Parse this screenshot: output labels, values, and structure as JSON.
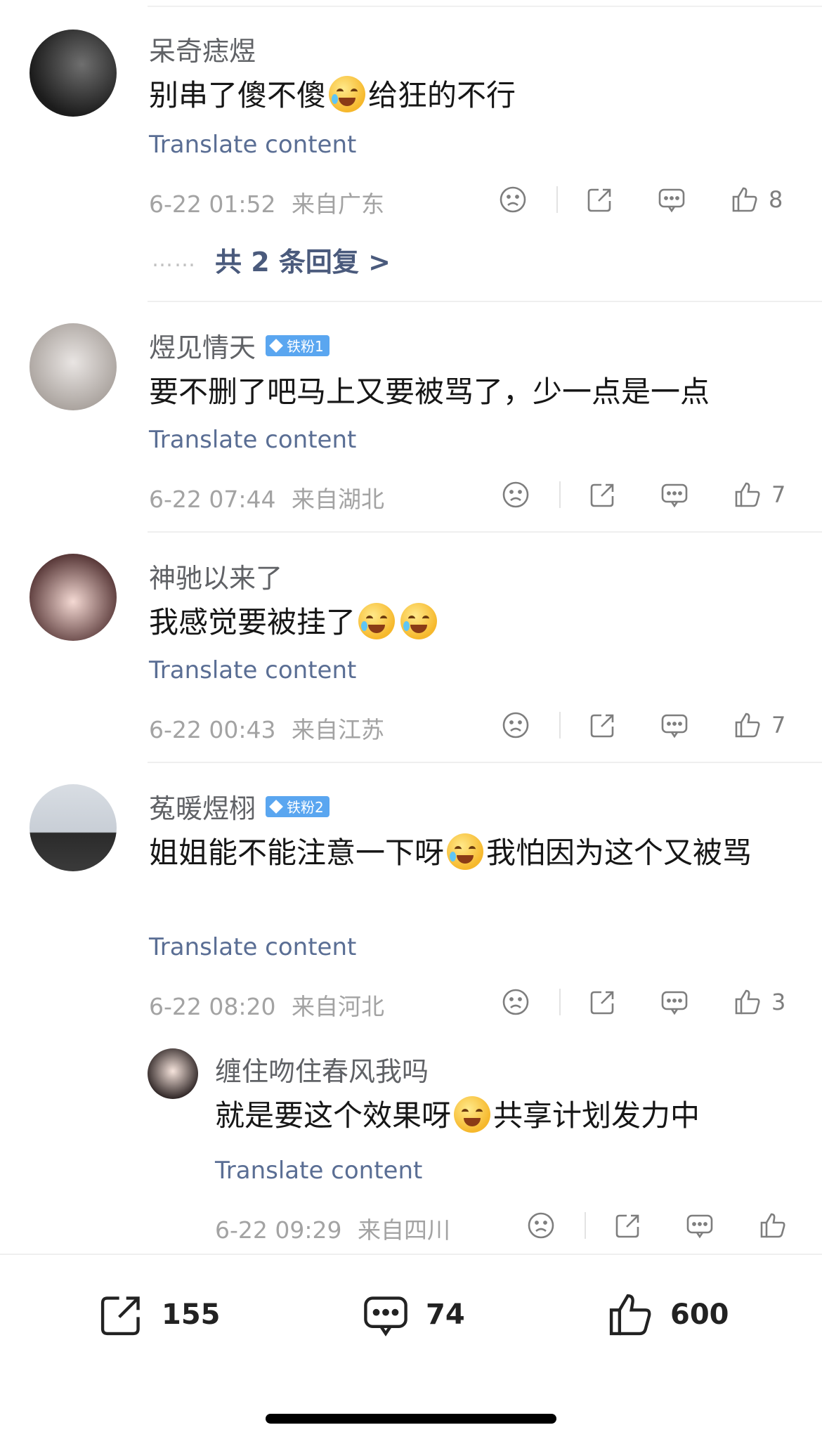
{
  "comments": [
    {
      "username": "呆奇痣煜",
      "badge": "",
      "text_parts": [
        "别串了傻不傻",
        "给狂的不行"
      ],
      "translate": "Translate content",
      "time": "6-22 01:52",
      "location": "来自广东",
      "likes": "8",
      "replies_link": "共 2 条回复 >",
      "replies_dots": "……"
    },
    {
      "username": "煜见情天",
      "badge": "铁粉1",
      "text": "要不删了吧马上又要被骂了，少一点是一点",
      "translate": "Translate content",
      "time": "6-22 07:44",
      "location": "来自湖北",
      "likes": "7"
    },
    {
      "username": "神驰以来了",
      "badge": "",
      "text": "我感觉要被挂了",
      "translate": "Translate content",
      "time": "6-22 00:43",
      "location": "来自江苏",
      "likes": "7"
    },
    {
      "username": "菟暖煜栩",
      "badge": "铁粉2",
      "text_parts": [
        "姐姐能不能注意一下呀",
        "我怕因为这个又被骂"
      ],
      "translate": "Translate content",
      "time": "6-22 08:20",
      "location": "来自河北",
      "likes": "3"
    },
    {
      "username": "缠住吻住春风我吗",
      "badge": "",
      "text_parts": [
        "就是要这个效果呀",
        "共享计划发力中"
      ],
      "translate": "Translate content",
      "time": "6-22 09:29",
      "location": "来自四川",
      "likes": ""
    }
  ],
  "bottom_bar": {
    "share_count": "155",
    "comment_count": "74",
    "like_count": "600"
  },
  "colors": {
    "translate_link": "#5a6e94",
    "badge_bg": "#5aa6f0",
    "meta_text": "#a3a3a3"
  },
  "icons": [
    "sad-face-icon",
    "share-icon",
    "comment-icon",
    "thumbs-up-icon",
    "laughing-crying-emoji",
    "crying-emoji",
    "smirk-emoji"
  ]
}
